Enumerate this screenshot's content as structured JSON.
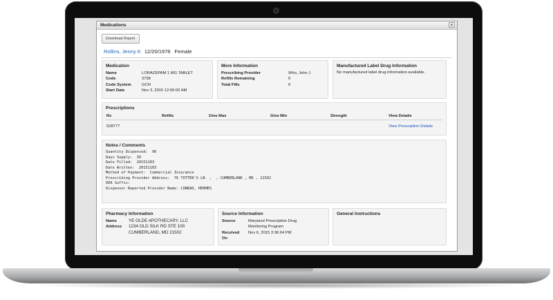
{
  "window": {
    "title": "Medications",
    "close_label": "✕"
  },
  "toolbar": {
    "download_label": "Download Report"
  },
  "patient": {
    "name": "Rollins, Jenny K",
    "dob": "12/20/1978",
    "gender": "Female"
  },
  "medication": {
    "title": "Medication",
    "rows": [
      {
        "key": "Name",
        "value": "LORAZEPAM 1 MG TABLET"
      },
      {
        "key": "Code",
        "value": "3758"
      },
      {
        "key": "Code System",
        "value": "GCN"
      },
      {
        "key": "Start Date",
        "value": "Nov 3, 2015 12:00:00 AM"
      }
    ]
  },
  "more_info": {
    "title": "More Information",
    "rows": [
      {
        "key": "Prescribing Provider",
        "value": "Who, John J"
      },
      {
        "key": "Refills Remaining",
        "value": "0"
      },
      {
        "key": "Total Fills",
        "value": "0"
      }
    ]
  },
  "label_info": {
    "title": "Manufactured Label Drug Information",
    "text": "No manufactured label drug information available."
  },
  "prescriptions": {
    "title": "Prescriptions",
    "columns": [
      "Rx",
      "Refills",
      "Give Max",
      "Give Min",
      "Strength",
      "View Details"
    ],
    "row": {
      "rx": "528777",
      "details_link": "View Prescription Details"
    }
  },
  "notes": {
    "title": "Notes / Comments",
    "lines": [
      "Quantity Dispensed:  90",
      "Days Supply:  30",
      "Date Filled:  20151103",
      "Date Written:  20151103",
      "Method of Payment:  Commercial Insurance",
      "Prescribing Provider Address:  76 TOTTER'S LN  ,  , CUMBERLAND , MD , 21502",
      "DEA Suffix:",
      "Dispenser Reported Provider Name: CONRAD, HERMES"
    ]
  },
  "pharmacy": {
    "title": "Pharmacy Information",
    "name_key": "Name",
    "name_value": "YE OLDE APOTHECARY, LLC",
    "address_key": "Address",
    "address_line1": "1234 OLD SILK RD STE 100",
    "address_line2": "CUMBERLAND, MD 21502"
  },
  "source": {
    "title": "Source Information",
    "source_key": "Source",
    "source_line1": "Maryland Prescription Drug",
    "source_line2": "Monitoring Program",
    "received_key1": "Received",
    "received_key2": "On",
    "received_value": "Nov 6, 2015 3:36:04 PM"
  },
  "instructions": {
    "title": "General Instructions"
  }
}
